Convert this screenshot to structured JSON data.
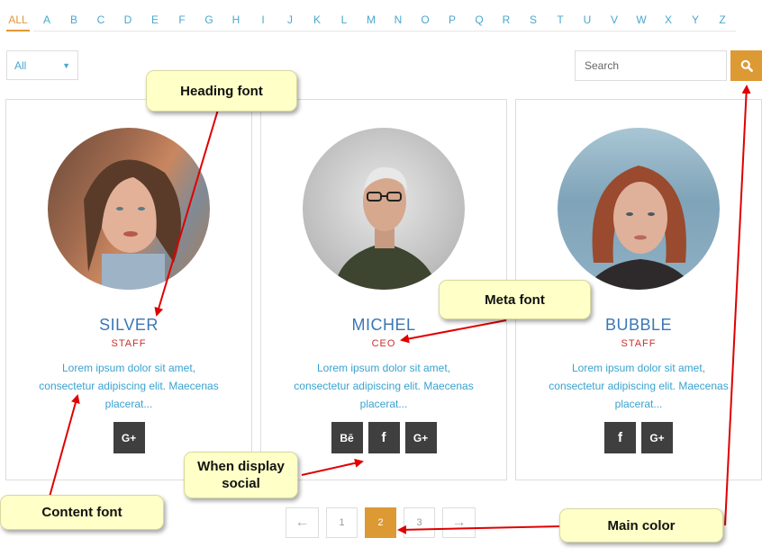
{
  "alphabet": {
    "letters": [
      "ALL",
      "A",
      "B",
      "C",
      "D",
      "E",
      "F",
      "G",
      "H",
      "I",
      "J",
      "K",
      "L",
      "M",
      "N",
      "O",
      "P",
      "Q",
      "R",
      "S",
      "T",
      "U",
      "V",
      "W",
      "X",
      "Y",
      "Z"
    ],
    "active": "ALL"
  },
  "filter": {
    "value": "All"
  },
  "search": {
    "placeholder": "Search"
  },
  "cards": [
    {
      "name": "SILVER",
      "role": "STAFF",
      "description": "Lorem ipsum dolor sit amet, consectetur adipiscing elit. Maecenas placerat..."
    },
    {
      "name": "MICHEL",
      "role": "CEO",
      "description": "Lorem ipsum dolor sit amet, consectetur adipiscing elit. Maecenas placerat..."
    },
    {
      "name": "BUBBLE",
      "role": "STAFF",
      "description": "Lorem ipsum dolor sit amet, consectetur adipiscing elit. Maecenas placerat..."
    }
  ],
  "social_labels": {
    "behance": "Bē",
    "facebook": "f",
    "google_plus": "G+"
  },
  "pagination": {
    "prev": "←",
    "pages": [
      "1",
      "2",
      "3"
    ],
    "current": "2",
    "next": "→"
  },
  "annotations": {
    "heading_font": "Heading font",
    "meta_font": "Meta font",
    "when_display_social": "When display social",
    "content_font": "Content font",
    "main_color": "Main color"
  },
  "colors": {
    "main": "#dd9933",
    "heading": "#3a77b5",
    "meta": "#c9302c",
    "content": "#3aa2cf",
    "arrow": "#e00000"
  }
}
